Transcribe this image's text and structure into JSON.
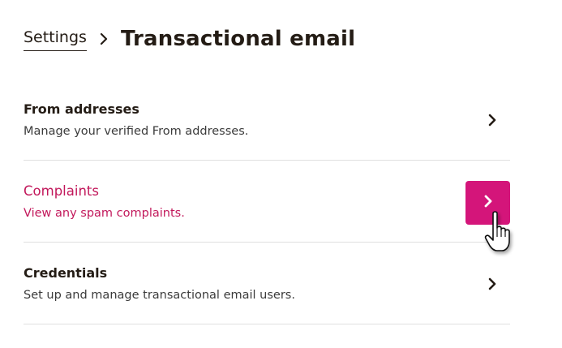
{
  "breadcrumb": {
    "parent_label": "Settings",
    "current_title": "Transactional email"
  },
  "items": [
    {
      "title": "From addresses",
      "description": "Manage your verified From addresses."
    },
    {
      "title": "Complaints",
      "description": "View any spam complaints."
    },
    {
      "title": "Credentials",
      "description": "Set up and manage transactional email users."
    }
  ],
  "colors": {
    "accent": "#d4157a",
    "accent_text": "#c2185b",
    "text": "#241c15",
    "divider": "#e0e0e0"
  },
  "icons": [
    "chevron-right-icon",
    "hand-pointer-icon"
  ]
}
